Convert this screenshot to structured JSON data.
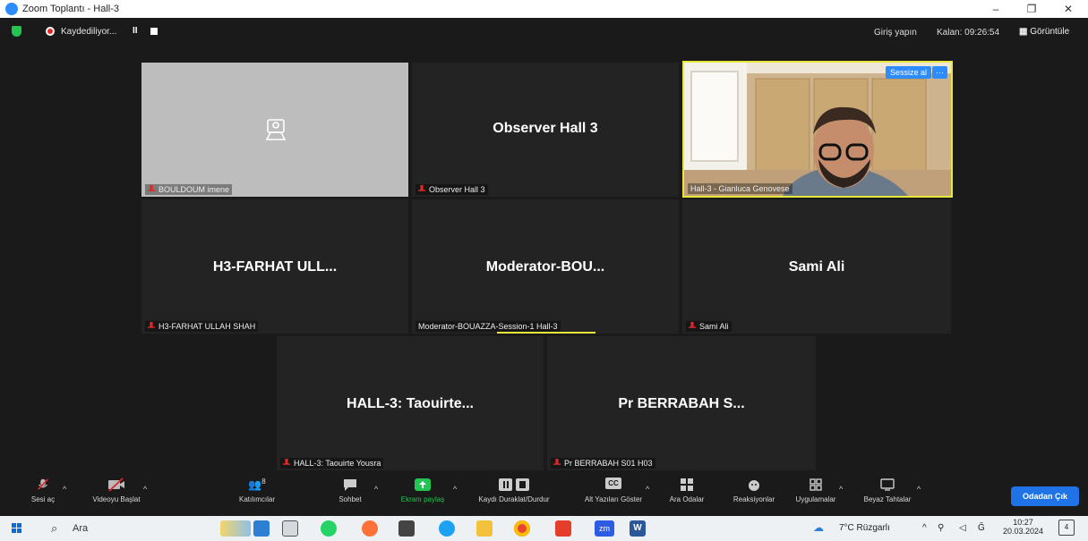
{
  "window": {
    "title": "Zoom Toplantı - Hall-3",
    "minimize": "–",
    "restore": "❐",
    "close": "✕"
  },
  "meeting_bar": {
    "recording_text": "Kaydediliyor...",
    "pause_symbol": "II",
    "sign_in": "Giriş yapın",
    "remaining": "Kalan: 09:26:54",
    "view_label": "Görüntüle",
    "view_icon": "grid-icon"
  },
  "tiles": [
    {
      "name": "",
      "label": "BOULDOUM imene",
      "type": "avatar"
    },
    {
      "name": "Observer Hall 3",
      "label": "Observer Hall 3",
      "type": "text"
    },
    {
      "name": "",
      "label": "Hall-3 - Gianluca Genovese",
      "type": "video",
      "mute_button": "Sessize al",
      "more_button": "···"
    },
    {
      "name": "H3-FARHAT ULL...",
      "label": "H3-FARHAT ULLAH SHAH",
      "type": "text"
    },
    {
      "name": "Moderator-BOU...",
      "label": "Moderator-BOUAZZA-Session-1 Hall-3",
      "type": "text"
    },
    {
      "name": "Sami Ali",
      "label": "Sami Ali",
      "type": "text"
    },
    {
      "name": "HALL-3: Taouirte...",
      "label": "HALL-3: Taouirte Yousra",
      "type": "text"
    },
    {
      "name": "Pr BERRABAH  S...",
      "label": "Pr BERRABAH  S01 H03",
      "type": "text"
    }
  ],
  "toolbar": {
    "audio": "Sesi aç",
    "video": "Videoyu Başlat",
    "participants": "Katılımcılar",
    "participants_count": "8",
    "chat": "Sohbet",
    "share": "Ekranı paylaş",
    "record": "Kaydı Duraklat/Durdur",
    "captions": "Alt Yazıları Göster",
    "captions_icon_text": "CC",
    "breakout": "Ara Odalar",
    "reactions": "Reaksiyonlar",
    "apps": "Uygulamalar",
    "whiteboard": "Beyaz Tahtalar",
    "leave": "Odadan Çık",
    "caret": "^"
  },
  "taskbar": {
    "search_placeholder": "Ara",
    "weather": "7°C  Rüzgarlı",
    "time": "10:27",
    "date": "20.03.2024",
    "notification_count": "4",
    "zoom_app_label": "zm"
  },
  "colors": {
    "accent_blue": "#2d8cff",
    "share_green": "#23c552",
    "active_speaker": "#e8e83a",
    "mic_off_red": "#e02828"
  }
}
